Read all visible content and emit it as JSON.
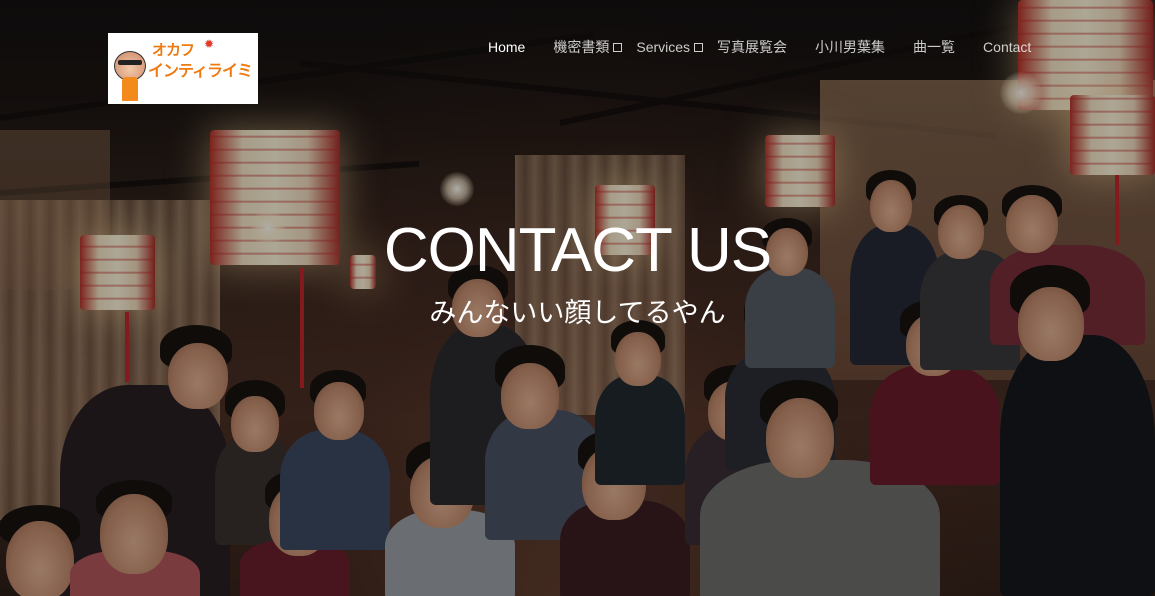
{
  "header": {
    "logo": {
      "line1": "オカフ",
      "line2": "インティライミ",
      "star": "✹"
    },
    "nav": [
      {
        "label": "Home",
        "active": true,
        "has_dropdown": false
      },
      {
        "label": "機密書類",
        "active": false,
        "has_dropdown": true
      },
      {
        "label": "Services",
        "active": false,
        "has_dropdown": true
      },
      {
        "label": "写真展覧会",
        "active": false,
        "has_dropdown": false
      },
      {
        "label": "小川男葉集",
        "active": false,
        "has_dropdown": false
      },
      {
        "label": "曲一覧",
        "active": false,
        "has_dropdown": false
      },
      {
        "label": "Contact",
        "active": false,
        "has_dropdown": false
      }
    ]
  },
  "hero": {
    "title": "CONTACT US",
    "subtitle": "みんないい顔してるやん"
  },
  "colors": {
    "logo_orange": "#f07a12",
    "lantern_red": "#c2272d",
    "text": "#ffffff"
  }
}
